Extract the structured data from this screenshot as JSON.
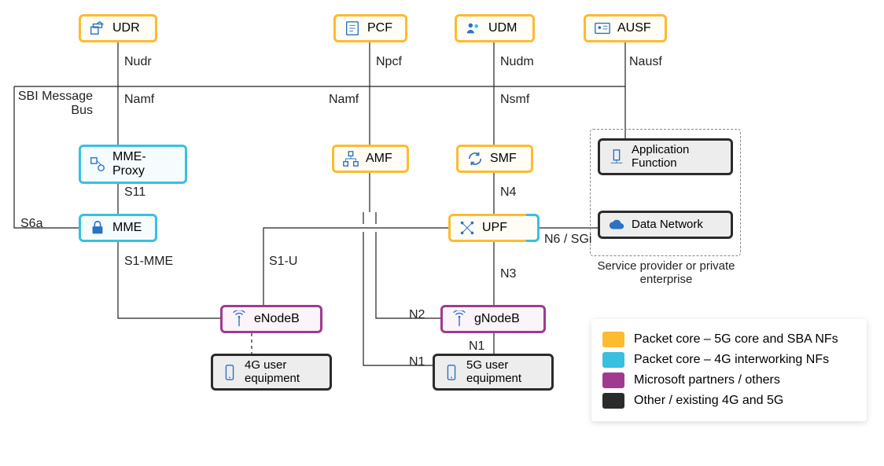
{
  "nodes": {
    "udr": {
      "label": "UDR"
    },
    "pcf": {
      "label": "PCF"
    },
    "udm": {
      "label": "UDM"
    },
    "ausf": {
      "label": "AUSF"
    },
    "mme_proxy": {
      "label": "MME-Proxy"
    },
    "mme": {
      "label": "MME"
    },
    "amf": {
      "label": "AMF"
    },
    "smf": {
      "label": "SMF"
    },
    "upf": {
      "label": "UPF"
    },
    "app_func": {
      "label": "Application Function"
    },
    "data_net": {
      "label": "Data Network"
    },
    "enodeb": {
      "label": "eNodeB"
    },
    "gnodeb": {
      "label": "gNodeB"
    },
    "ue4g": {
      "label": "4G user equipment"
    },
    "ue5g": {
      "label": "5G user equipment"
    }
  },
  "edges": {
    "nudr": "Nudr",
    "npcf": "Npcf",
    "nudm": "Nudm",
    "nausf": "Nausf",
    "namf1": "Namf",
    "namf2": "Namf",
    "nsmf": "Nsmf",
    "sbi": "SBI Message Bus",
    "s11": "S11",
    "s6a": "S6a",
    "s1mme": "S1-MME",
    "s1u": "S1-U",
    "n1": "N1",
    "n1b": "N1",
    "n2": "N2",
    "n3": "N3",
    "n4": "N4",
    "n6sgi": "N6 / SGi"
  },
  "enterprise_caption": "Service provider or private enterprise",
  "legend": [
    {
      "color": "yellow",
      "text": "Packet core – 5G core and SBA NFs"
    },
    {
      "color": "cyan",
      "text": "Packet core – 4G interworking NFs"
    },
    {
      "color": "purple",
      "text": "Microsoft partners / others"
    },
    {
      "color": "dark",
      "text": "Other / existing 4G and 5G"
    }
  ]
}
